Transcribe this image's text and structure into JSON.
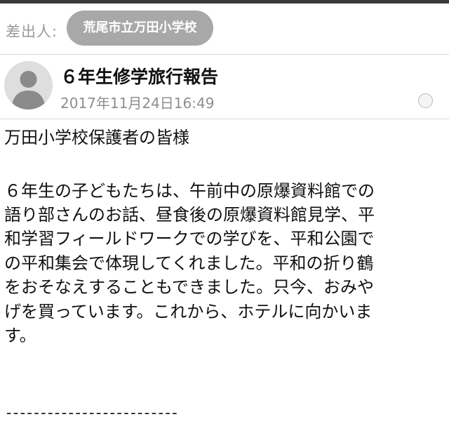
{
  "sender": {
    "label": "差出人:",
    "name": "荒尾市立万田小学校"
  },
  "message": {
    "avatar_icon": "person-avatar-icon",
    "subject": "６年生修学旅行報告",
    "date": "2017年11月24日16:49",
    "status_icon": "read-status-circle-icon"
  },
  "body": {
    "greeting": "万田小学校保護者の皆様",
    "lines": [
      "６年生の子どもたちは、午前中の原爆資料館での",
      "語り部さんのお話、昼食後の原爆資料館見学、平",
      "和学習フィールドワークでの学びを、平和公園で",
      "の平和集会で体現してくれました。平和の折り鶴",
      "をおそなえすることもできました。只今、おみや",
      "げを買っています。これから、ホテルに向かいま",
      "す。"
    ],
    "separator": "-------------------------"
  },
  "colors": {
    "chip_background": "#a8a8a8",
    "muted_text": "#9a9a9a",
    "divider": "#d9d9d9"
  }
}
